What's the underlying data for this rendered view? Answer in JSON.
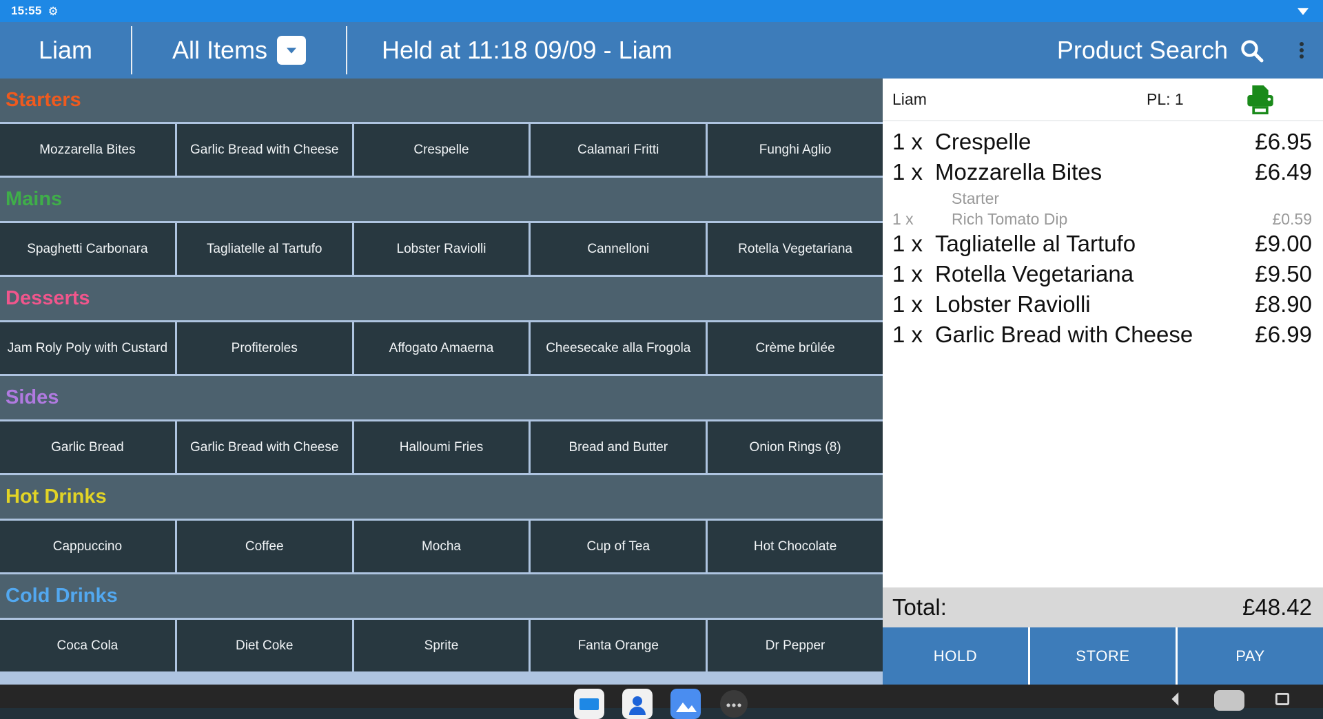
{
  "statusbar": {
    "time": "15:55",
    "gear_icon": "gear-icon",
    "wifi_icon": "wifi-icon"
  },
  "toolbar": {
    "user": "Liam",
    "filter_label": "All Items",
    "filter_chevron_icon": "chevron-down-icon",
    "title": "Held at 11:18 09/09 - Liam",
    "search_label": "Product Search",
    "search_icon": "search-icon",
    "overflow_icon": "kebab-menu-icon"
  },
  "menu": {
    "categories": [
      {
        "name": "Starters",
        "color": "#ef5a1e",
        "items": [
          "Mozzarella Bites",
          "Garlic Bread with Cheese",
          "Crespelle",
          "Calamari Fritti",
          "Funghi Aglio"
        ]
      },
      {
        "name": "Mains",
        "color": "#3fae49",
        "items": [
          "Spaghetti Carbonara",
          "Tagliatelle al Tartufo",
          "Lobster Raviolli",
          "Cannelloni",
          "Rotella Vegetariana"
        ]
      },
      {
        "name": "Desserts",
        "color": "#f0568c",
        "items": [
          "Jam Roly Poly with Custard",
          "Profiteroles",
          "Affogato Amaerna",
          "Cheesecake alla Frogola",
          "Crème brûlée"
        ]
      },
      {
        "name": "Sides",
        "color": "#b07ae0",
        "items": [
          "Garlic Bread",
          "Garlic Bread with Cheese",
          "Halloumi Fries",
          "Bread and Butter",
          "Onion Rings (8)"
        ]
      },
      {
        "name": "Hot Drinks",
        "color": "#e2d426",
        "items": [
          "Cappuccino",
          "Coffee",
          "Mocha",
          "Cup of Tea",
          "Hot Chocolate"
        ]
      },
      {
        "name": "Cold Drinks",
        "color": "#52a8f0",
        "items": [
          "Coca Cola",
          "Diet Coke",
          "Sprite",
          "Fanta Orange",
          "Dr Pepper"
        ]
      }
    ]
  },
  "order": {
    "header_user": "Liam",
    "header_pl": "PL: 1",
    "printer_icon": "printer-icon",
    "printer_color": "#1a8a1a",
    "lines": [
      {
        "type": "item",
        "qty": "1 x",
        "name": "Crespelle",
        "price": "£6.95"
      },
      {
        "type": "item",
        "qty": "1 x",
        "name": "Mozzarella Bites",
        "price": "£6.49"
      },
      {
        "type": "modgroup",
        "qty": "",
        "name": "Starter",
        "price": ""
      },
      {
        "type": "mod",
        "qty": "1 x",
        "name": "Rich Tomato Dip",
        "price": "£0.59"
      },
      {
        "type": "item",
        "qty": "1 x",
        "name": "Tagliatelle al Tartufo",
        "price": "£9.00"
      },
      {
        "type": "item",
        "qty": "1 x",
        "name": "Rotella Vegetariana",
        "price": "£9.50"
      },
      {
        "type": "item",
        "qty": "1 x",
        "name": "Lobster Raviolli",
        "price": "£8.90"
      },
      {
        "type": "item",
        "qty": "1 x",
        "name": "Garlic Bread with Cheese",
        "price": "£6.99"
      }
    ],
    "total_label": "Total:",
    "total_value": "£48.42",
    "actions": [
      "HOLD",
      "STORE",
      "PAY"
    ]
  },
  "navbar": {
    "dock_icons": [
      "messages-icon",
      "contacts-icon",
      "photos-icon",
      "more-icon"
    ],
    "back_icon": "back-icon",
    "home_icon": "home-icon",
    "recents_icon": "recents-icon"
  },
  "theme": {
    "accent": "#3d7cba",
    "statusbar": "#1e88e5",
    "tile": "#283840",
    "category_bg": "#4c616e",
    "grid_gap": "#aec4e0"
  }
}
